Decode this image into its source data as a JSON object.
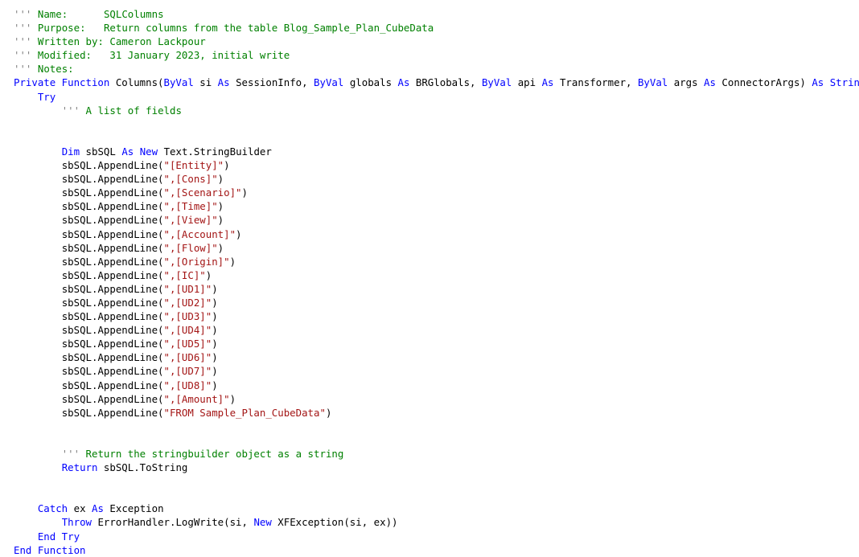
{
  "editor": {
    "language": "VB.NET",
    "background": "#ffffff",
    "colors": {
      "plain": "#000000",
      "keyword": "#0000ff",
      "comment": "#008000",
      "comment_marker": "#808080",
      "string": "#a31515"
    }
  },
  "header": {
    "name_label": "Name:",
    "name_value": "SQLColumns",
    "purpose_label": "Purpose:",
    "purpose_value": "Return columns from the table Blog_Sample_Plan_CubeData",
    "written_by_label": "Written by:",
    "written_by_value": "Cameron Lackpour",
    "modified_label": "Modified:",
    "modified_value": "31 January 2023, initial write",
    "notes_label": "Notes:"
  },
  "comments": {
    "marker": "'''",
    "fields_list": "A list of fields",
    "return_string": "Return the stringbuilder object as a string"
  },
  "signature": {
    "full": "Private Function Columns(ByVal si As SessionInfo, ByVal globals As BRGlobals, ByVal api As Transformer, ByVal args As ConnectorArgs) As String",
    "function_name": "Columns",
    "return_type": "String",
    "parameters": [
      {
        "name": "si",
        "type": "SessionInfo"
      },
      {
        "name": "globals",
        "type": "BRGlobals"
      },
      {
        "name": "api",
        "type": "Transformer"
      },
      {
        "name": "args",
        "type": "ConnectorArgs"
      }
    ]
  },
  "variables": {
    "builder_name": "sbSQL",
    "builder_type": "Text.StringBuilder",
    "exception_var": "ex",
    "exception_type": "Exception"
  },
  "append_lines": [
    "\"[Entity]\"",
    "\",[Cons]\"",
    "\",[Scenario]\"",
    "\",[Time]\"",
    "\",[View]\"",
    "\",[Account]\"",
    "\",[Flow]\"",
    "\",[Origin]\"",
    "\",[IC]\"",
    "\",[UD1]\"",
    "\",[UD2]\"",
    "\",[UD3]\"",
    "\",[UD4]\"",
    "\",[UD5]\"",
    "\",[UD6]\"",
    "\",[UD7]\"",
    "\",[UD8]\"",
    "\",[Amount]\"",
    "\"FROM Sample_Plan_CubeData\""
  ],
  "statements": {
    "try": "Try",
    "dim": "Dim",
    "as": "As",
    "new": "New",
    "return": "Return",
    "return_expr": "sbSQL.ToString",
    "catch": "Catch",
    "throw": "Throw",
    "throw_expr": "ErrorHandler.LogWrite(si, New XFException(si, ex))",
    "end_try": "End Try",
    "end_function": "End Function",
    "append_call": "sbSQL.AppendLine("
  }
}
